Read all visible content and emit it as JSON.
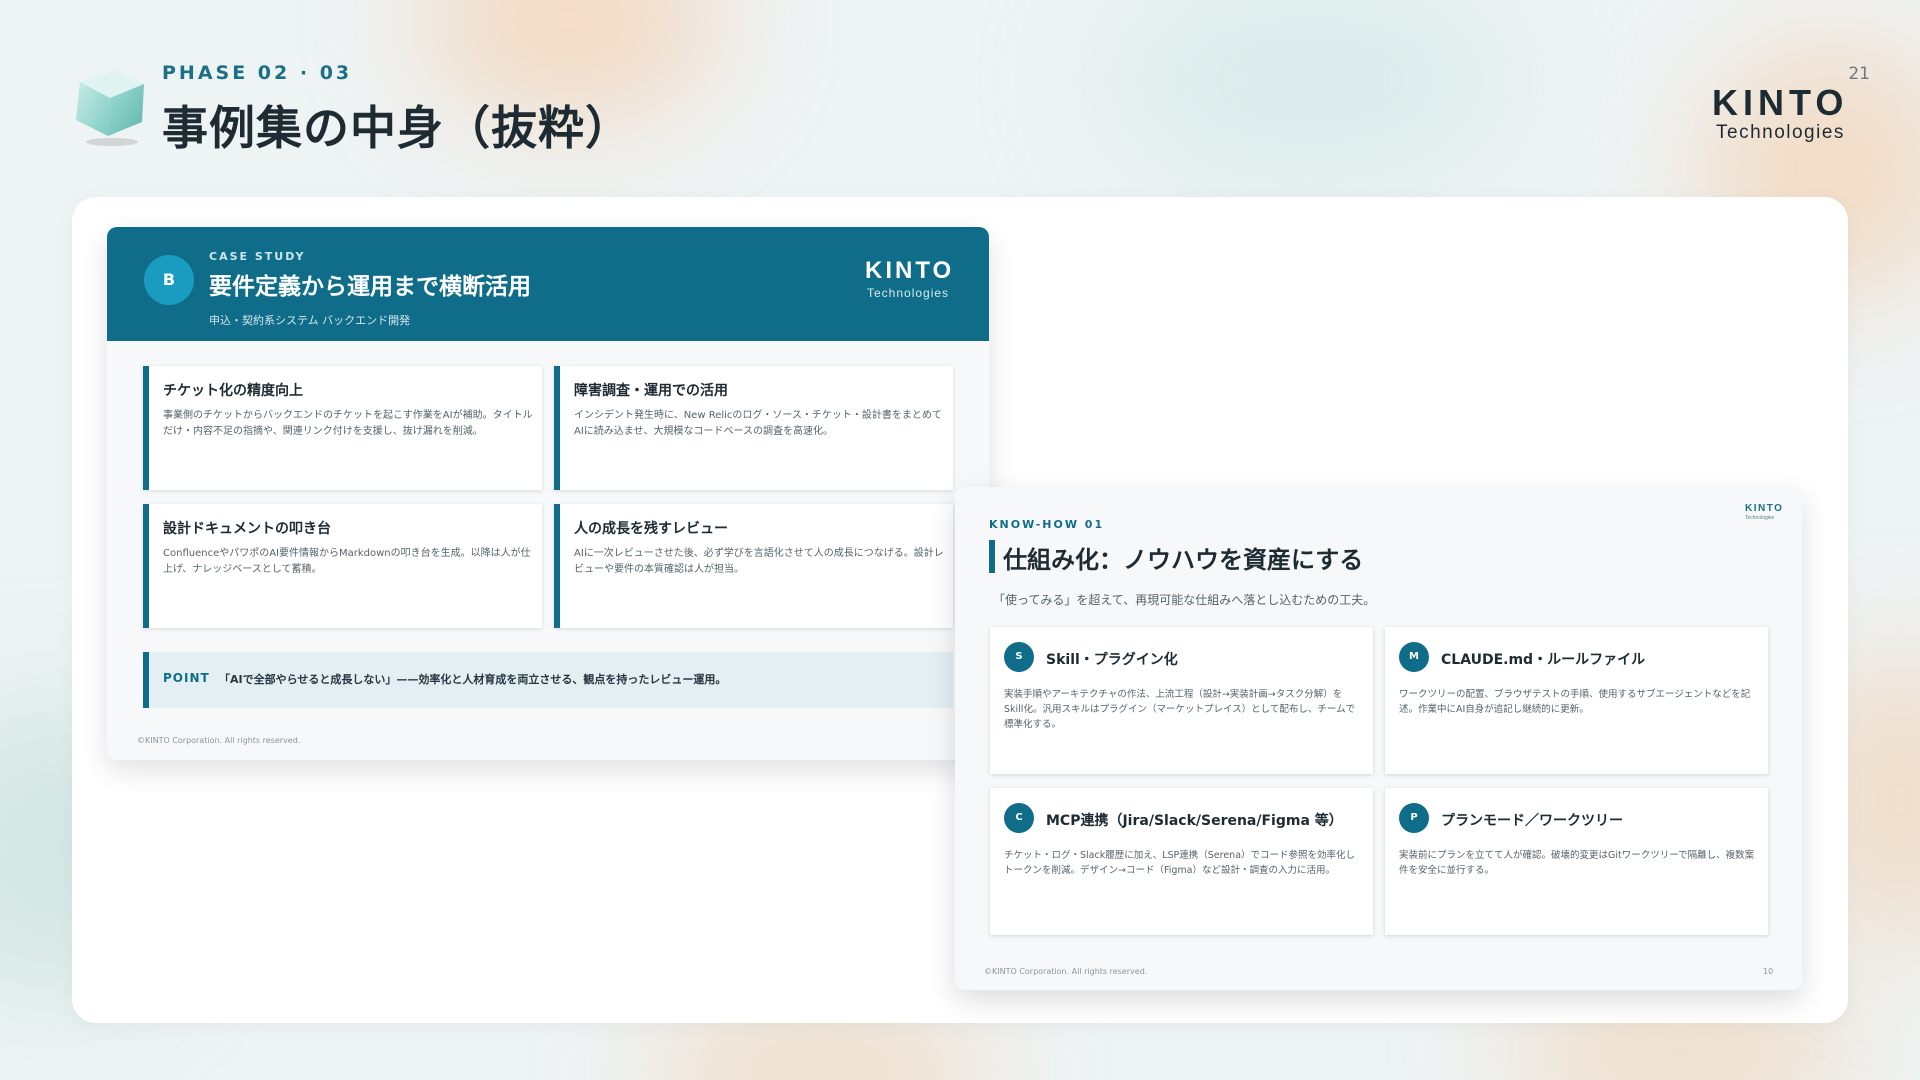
{
  "header": {
    "phase": "PHASE 02 · 03",
    "title": "事例集の中身（抜粋）",
    "page_number": "21",
    "logo_main": "KINTO",
    "logo_sub": "Technologies"
  },
  "slide_case": {
    "badge": "B",
    "eyebrow": "CASE STUDY",
    "title": "要件定義から運用まで横断活用",
    "subtitle": "申込・契約系システム バックエンド開発",
    "logo_main": "KINTO",
    "logo_sub": "Technologies",
    "cards": [
      {
        "title": "チケット化の精度向上",
        "desc": "事業側のチケットからバックエンドのチケットを起こす作業をAIが補助。タイトルだけ・内容不足の指摘や、関連リンク付けを支援し、抜け漏れを削減。"
      },
      {
        "title": "障害調査・運用での活用",
        "desc": "インシデント発生時に、New Relicのログ・ソース・チケット・設計書をまとめてAIに読み込ませ、大規模なコードベースの調査を高速化。"
      },
      {
        "title": "設計ドキュメントの叩き台",
        "desc": "ConfluenceやパワポのAI要件情報からMarkdownの叩き台を生成。以降は人が仕上げ、ナレッジベースとして蓄積。"
      },
      {
        "title": "人の成長を残すレビュー",
        "desc": "AIに一次レビューさせた後、必ず学びを言語化させて人の成長につなげる。設計レビューや要件の本質確認は人が担当。"
      }
    ],
    "point_label": "POINT",
    "point_text": "「AIで全部やらせると成長しない」——効率化と人材育成を両立させる、観点を持ったレビュー運用。",
    "copyright": "©KINTO Corporation. All rights reserved."
  },
  "slide_knowhow": {
    "eyebrow": "KNOW-HOW 01",
    "title": "仕組み化：ノウハウを資産にする",
    "subtitle": "「使ってみる」を超えて、再現可能な仕組みへ落とし込むための工夫。",
    "logo_main": "KINTO",
    "logo_sub": "Technologies",
    "cards": [
      {
        "icon": "S",
        "title": "Skill・プラグイン化",
        "desc": "実装手順やアーキテクチャの作法、上流工程（設計→実装計画→タスク分解）をSkill化。汎用スキルはプラグイン（マーケットプレイス）として配布し、チームで標準化する。"
      },
      {
        "icon": "M",
        "title": "CLAUDE.md・ルールファイル",
        "desc": "ワークツリーの配置、ブラウザテストの手順、使用するサブエージェントなどを記述。作業中にAI自身が追記し継続的に更新。"
      },
      {
        "icon": "C",
        "title": "MCP連携（Jira/Slack/Serena/Figma 等）",
        "desc": "チケット・ログ・Slack履歴に加え、LSP連携（Serena）でコード参照を効率化しトークンを削減。デザイン→コード（Figma）など設計・調査の入力に活用。"
      },
      {
        "icon": "P",
        "title": "プランモード／ワークツリー",
        "desc": "実装前にプランを立てて人が確認。破壊的変更はGitワークツリーで隔離し、複数案件を安全に並行する。"
      }
    ],
    "copyright": "©KINTO Corporation. All rights reserved.",
    "page_number": "10"
  }
}
